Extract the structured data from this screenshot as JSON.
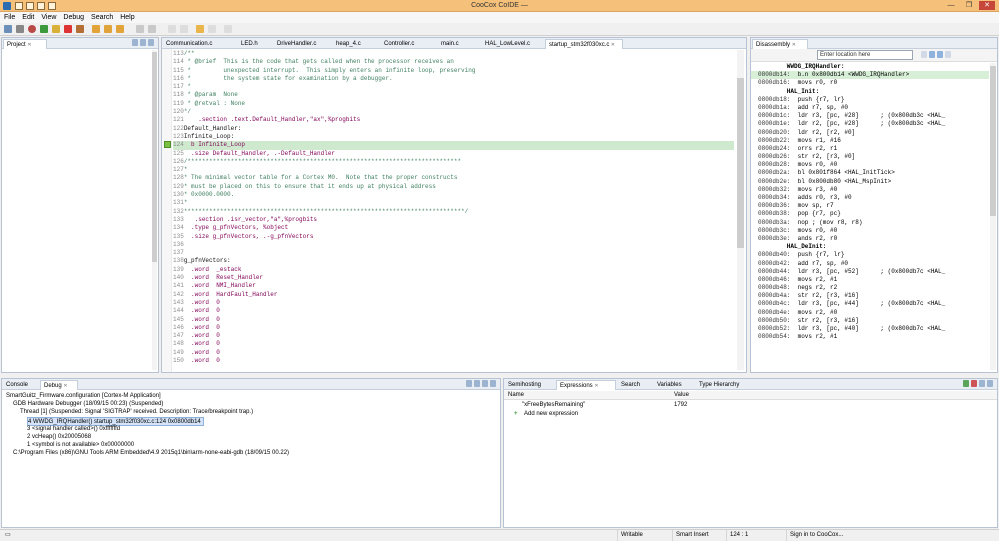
{
  "window": {
    "title": "CooCox CoIDE —",
    "controls": [
      "—",
      "❐",
      "✕"
    ]
  },
  "menu": [
    "File",
    "Edit",
    "View",
    "Debug",
    "Search",
    "Help"
  ],
  "project_tab": {
    "label": "Project"
  },
  "editor": {
    "tabs": [
      "Communication.c",
      "LED.h",
      "DriveHandler.c",
      "heap_4.c",
      "Controller.c",
      "main.c",
      "HAL_LowLevel.c",
      "startup_stm32f030xc.c"
    ],
    "lines": [
      {
        "n": "113",
        "t": "/**",
        "cls": "cm"
      },
      {
        "n": "114",
        "t": " * @brief  This is the code that gets called when the processor receives an",
        "cls": "cm"
      },
      {
        "n": "115",
        "t": " *         unexpected interrupt.  This simply enters an infinite loop, preserving",
        "cls": "cm"
      },
      {
        "n": "116",
        "t": " *         the system state for examination by a debugger.",
        "cls": "cm"
      },
      {
        "n": "117",
        "t": " *",
        "cls": "cm"
      },
      {
        "n": "118",
        "t": " * @param  None",
        "cls": "cm"
      },
      {
        "n": "119",
        "t": " * @retval : None",
        "cls": "cm"
      },
      {
        "n": "120",
        "t": "*/",
        "cls": "cm"
      },
      {
        "n": "121",
        "t": "    .section .text.Default_Handler,\"ax\",%progbits",
        "cls": "kw"
      },
      {
        "n": "122",
        "t": "Default_Handler:",
        "cls": "lb"
      },
      {
        "n": "123",
        "t": "Infinite_Loop:",
        "cls": "lb"
      },
      {
        "n": "124",
        "t": "  b Infinite_Loop",
        "cls": "cur"
      },
      {
        "n": "125",
        "t": "  .size Default_Handler, .-Default_Handler",
        "cls": "kw"
      },
      {
        "n": "126",
        "t": "/****************************************************************************",
        "cls": "cm"
      },
      {
        "n": "127",
        "t": "*",
        "cls": "cm"
      },
      {
        "n": "128",
        "t": "* The minimal vector table for a Cortex M0.  Note that the proper constructs",
        "cls": "cm"
      },
      {
        "n": "129",
        "t": "* must be placed on this to ensure that it ends up at physical address",
        "cls": "cm"
      },
      {
        "n": "130",
        "t": "* 0x0000.0000.",
        "cls": "cm"
      },
      {
        "n": "131",
        "t": "*",
        "cls": "cm"
      },
      {
        "n": "132",
        "t": "******************************************************************************/",
        "cls": "cm"
      },
      {
        "n": "133",
        "t": "   .section .isr_vector,\"a\",%progbits",
        "cls": "kw"
      },
      {
        "n": "134",
        "t": "  .type g_pfnVectors, %object",
        "cls": "kw"
      },
      {
        "n": "135",
        "t": "  .size g_pfnVectors, .-g_pfnVectors",
        "cls": "kw"
      },
      {
        "n": "136",
        "t": "",
        "cls": "lb"
      },
      {
        "n": "137",
        "t": "",
        "cls": "lb"
      },
      {
        "n": "138",
        "t": "g_pfnVectors:",
        "cls": "lb"
      },
      {
        "n": "139",
        "t": "  .word  _estack",
        "cls": "kw"
      },
      {
        "n": "140",
        "t": "  .word  Reset_Handler",
        "cls": "kw"
      },
      {
        "n": "141",
        "t": "  .word  NMI_Handler",
        "cls": "kw"
      },
      {
        "n": "142",
        "t": "  .word  HardFault_Handler",
        "cls": "kw"
      },
      {
        "n": "143",
        "t": "  .word  0",
        "cls": "kw"
      },
      {
        "n": "144",
        "t": "  .word  0",
        "cls": "kw"
      },
      {
        "n": "145",
        "t": "  .word  0",
        "cls": "kw"
      },
      {
        "n": "146",
        "t": "  .word  0",
        "cls": "kw"
      },
      {
        "n": "147",
        "t": "  .word  0",
        "cls": "kw"
      },
      {
        "n": "148",
        "t": "  .word  0",
        "cls": "kw"
      },
      {
        "n": "149",
        "t": "  .word  0",
        "cls": "kw"
      },
      {
        "n": "150",
        "t": "  .word  0",
        "cls": "kw"
      }
    ]
  },
  "disassembly": {
    "tab": "Disassembly",
    "location_placeholder": "Enter location here",
    "lines": [
      {
        "a": "",
        "t": "        WWDG_IRQHandler:",
        "cls": "sym"
      },
      {
        "a": "0800db14:",
        "t": "  b.n 0x800db14 <WWDG_IRQHandler>",
        "cls": "dcur"
      },
      {
        "a": "0800db16:",
        "t": "  movs r0, r0",
        "cls": ""
      },
      {
        "a": "",
        "t": "        HAL_Init:",
        "cls": "sym"
      },
      {
        "a": "0800db18:",
        "t": "  push {r7, lr}",
        "cls": ""
      },
      {
        "a": "0800db1a:",
        "t": "  add r7, sp, #0",
        "cls": ""
      },
      {
        "a": "0800db1c:",
        "t": "  ldr r3, [pc, #28]      ; (0x800db3c <HAL_",
        "cls": ""
      },
      {
        "a": "0800db1e:",
        "t": "  ldr r2, [pc, #28]      ; (0x800db3c <HAL_",
        "cls": ""
      },
      {
        "a": "0800db20:",
        "t": "  ldr r2, [r2, #0]",
        "cls": ""
      },
      {
        "a": "0800db22:",
        "t": "  movs r1, #16",
        "cls": ""
      },
      {
        "a": "0800db24:",
        "t": "  orrs r2, r1",
        "cls": ""
      },
      {
        "a": "0800db26:",
        "t": "  str r2, [r3, #0]",
        "cls": ""
      },
      {
        "a": "0800db28:",
        "t": "  movs r0, #0",
        "cls": ""
      },
      {
        "a": "0800db2a:",
        "t": "  bl 0x801f864 <HAL_InitTick>",
        "cls": ""
      },
      {
        "a": "0800db2e:",
        "t": "  bl 0x800db80 <HAL_MspInit>",
        "cls": ""
      },
      {
        "a": "0800db32:",
        "t": "  movs r3, #0",
        "cls": ""
      },
      {
        "a": "0800db34:",
        "t": "  adds r0, r3, #0",
        "cls": ""
      },
      {
        "a": "0800db36:",
        "t": "  mov sp, r7",
        "cls": ""
      },
      {
        "a": "0800db38:",
        "t": "  pop {r7, pc}",
        "cls": ""
      },
      {
        "a": "0800db3a:",
        "t": "  nop ; (mov r8, r8)",
        "cls": ""
      },
      {
        "a": "0800db3c:",
        "t": "  movs r0, #0",
        "cls": ""
      },
      {
        "a": "0800db3e:",
        "t": "  ands r2, r0",
        "cls": ""
      },
      {
        "a": "",
        "t": "        HAL_DeInit:",
        "cls": "sym"
      },
      {
        "a": "0800db40:",
        "t": "  push {r7, lr}",
        "cls": ""
      },
      {
        "a": "0800db42:",
        "t": "  add r7, sp, #0",
        "cls": ""
      },
      {
        "a": "0800db44:",
        "t": "  ldr r3, [pc, #52]      ; (0x800db7c <HAL_",
        "cls": ""
      },
      {
        "a": "0800db46:",
        "t": "  movs r2, #1",
        "cls": ""
      },
      {
        "a": "0800db48:",
        "t": "  negs r2, r2",
        "cls": ""
      },
      {
        "a": "0800db4a:",
        "t": "  str r2, [r3, #16]",
        "cls": ""
      },
      {
        "a": "0800db4c:",
        "t": "  ldr r3, [pc, #44]      ; (0x800db7c <HAL_",
        "cls": ""
      },
      {
        "a": "0800db4e:",
        "t": "  movs r2, #0",
        "cls": ""
      },
      {
        "a": "0800db50:",
        "t": "  str r2, [r3, #16]",
        "cls": ""
      },
      {
        "a": "0800db52:",
        "t": "  ldr r3, [pc, #40]      ; (0x800db7c <HAL_",
        "cls": ""
      },
      {
        "a": "0800db54:",
        "t": "  movs r2, #1",
        "cls": ""
      }
    ]
  },
  "debug": {
    "tabs": [
      "Console",
      "Debug"
    ],
    "tree": [
      {
        "t": "SmartGuitz_Firmware.configuration [Cortex-M Application]",
        "indent": 0,
        "sel": false
      },
      {
        "t": "GDB Hardware Debugger (18/09/15 00:23) (Suspended)",
        "indent": 1,
        "sel": false
      },
      {
        "t": "Thread [1] (Suspended: Signal 'SIGTRAP' received. Description: Trace/breakpoint trap.)",
        "indent": 2,
        "sel": false
      },
      {
        "t": "4 WWDG_IRQHandler() startup_stm32f030xc.c:124 0x0800db14",
        "indent": 3,
        "sel": true
      },
      {
        "t": "3 <signal handler called>() 0xfffffffd",
        "indent": 3,
        "sel": false
      },
      {
        "t": "2 vcHeap() 0x20005068",
        "indent": 3,
        "sel": false
      },
      {
        "t": "1 <symbol is not available> 0x00000000",
        "indent": 3,
        "sel": false
      },
      {
        "t": "C:\\Program Files (x86)\\GNU Tools ARM Embedded\\4.9 2015q1\\bin\\arm-none-eabi-gdb (18/09/15 00.22)",
        "indent": 1,
        "sel": false
      }
    ]
  },
  "expressions": {
    "tabs": [
      "Semihosting",
      "Expressions",
      "Search",
      "Variables",
      "Type Hierarchy"
    ],
    "headers": [
      "Name",
      "Value"
    ],
    "rows": [
      {
        "name": "\"xFreeBytesRemaining\"",
        "value": "1792"
      }
    ],
    "add_label": "Add new expression"
  },
  "status": {
    "writable": "Writable",
    "insert": "Smart Insert",
    "pos": "124 : 1",
    "signin": "Sign in to CooCox..."
  }
}
